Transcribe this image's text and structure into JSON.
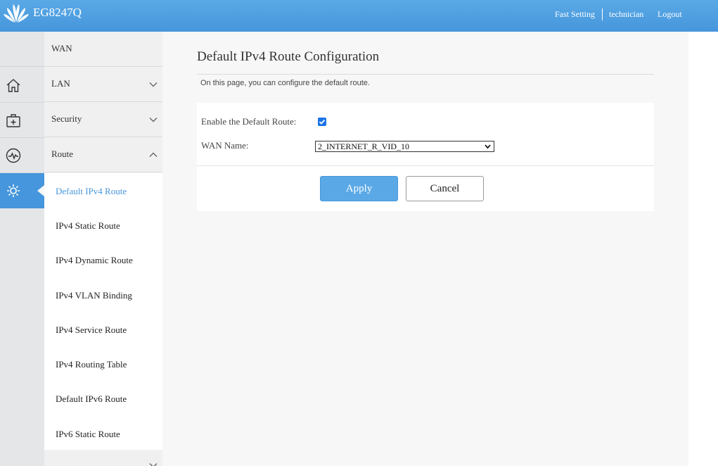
{
  "header": {
    "model": "EG8247Q",
    "fast_setting": "Fast Setting",
    "user": "technician",
    "logout": "Logout"
  },
  "rail": {
    "icons": [
      "home-icon",
      "medkit-icon",
      "pulse-icon",
      "gear-icon"
    ],
    "active_index": 3
  },
  "menu": {
    "wan": "WAN",
    "lan": "LAN",
    "security": "Security",
    "route": "Route",
    "route_items": [
      "Default IPv4 Route",
      "IPv4 Static Route",
      "IPv4 Dynamic Route",
      "IPv4 VLAN Binding",
      "IPv4 Service Route",
      "IPv4 Routing Table",
      "Default IPv6 Route",
      "IPv6 Static Route"
    ],
    "active_route_item": 0
  },
  "main": {
    "title": "Default IPv4 Route Configuration",
    "description": "On this page, you can configure the default route.",
    "enable_label": "Enable the Default Route:",
    "enable_checked": true,
    "wan_label": "WAN Name:",
    "wan_value": "2_INTERNET_R_VID_10",
    "apply_label": "Apply",
    "cancel_label": "Cancel"
  },
  "colors": {
    "accent": "#4596dc",
    "header": "#5aa9e6"
  }
}
